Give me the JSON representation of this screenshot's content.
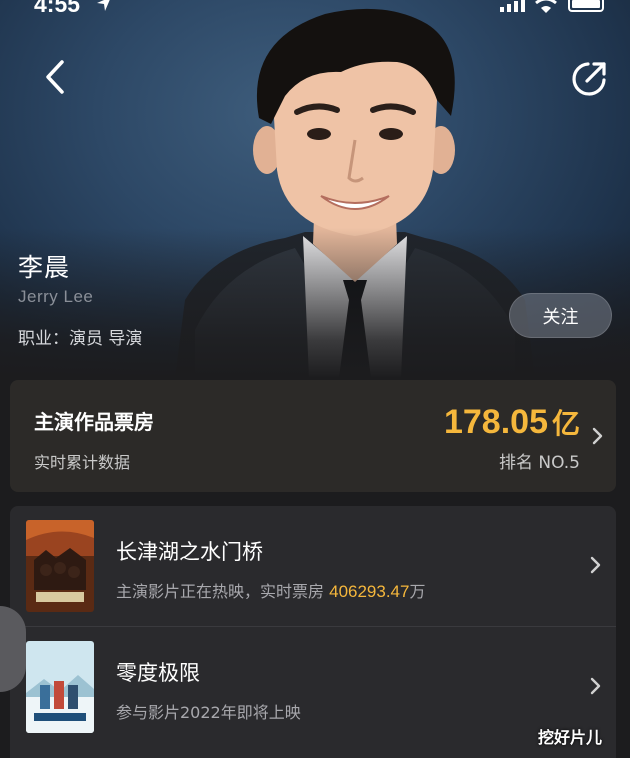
{
  "status_bar": {
    "time": "4:55"
  },
  "person": {
    "name_cn": "李晨",
    "name_en": "Jerry Lee",
    "profession": "职业：演员 导演"
  },
  "actions": {
    "follow_label": "关注"
  },
  "box_office": {
    "title": "主演作品票房",
    "subtitle": "实时累计数据",
    "amount": "178.05",
    "unit": "亿",
    "rank": "排名 NO.5"
  },
  "films": [
    {
      "title": "长津湖之水门桥",
      "desc_prefix": "主演影片正在热映，实时票房",
      "desc_value": "406293.47",
      "desc_suffix": "万"
    },
    {
      "title": "零度极限",
      "desc_prefix": "参与影片2022年即将上映"
    }
  ],
  "watermark": "挖好片儿",
  "icons": {
    "back": "chevron-left-icon",
    "share": "share-icon",
    "chevron": "chevron-right-icon"
  },
  "colors": {
    "accent": "#f5b73c",
    "background": "#1c1c1e",
    "box_card": "#2c2a28"
  }
}
